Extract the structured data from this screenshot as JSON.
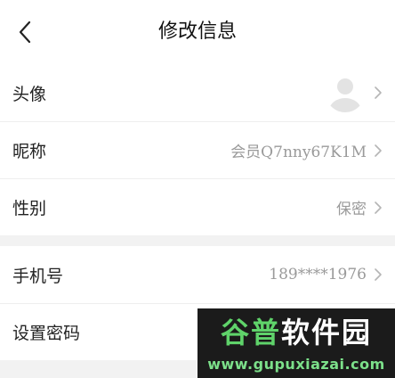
{
  "header": {
    "title": "修改信息",
    "back_icon": "chevron-left-icon"
  },
  "profile_rows": [
    {
      "label": "头像",
      "value": ""
    },
    {
      "label": "昵称",
      "value": "会员Q7nny67K1M"
    },
    {
      "label": "性别",
      "value": "保密"
    }
  ],
  "account_rows": [
    {
      "label": "手机号",
      "value": "189****1976"
    },
    {
      "label": "设置密码",
      "value": ""
    }
  ],
  "watermark": {
    "line1_a": "谷普",
    "line1_b": "软件园",
    "line2": "www.gupuxiazai.com"
  },
  "colors": {
    "background": "#f2f2f2",
    "card": "#ffffff",
    "value_text": "#9a9a9a",
    "chevron": "#b5b5b5"
  }
}
